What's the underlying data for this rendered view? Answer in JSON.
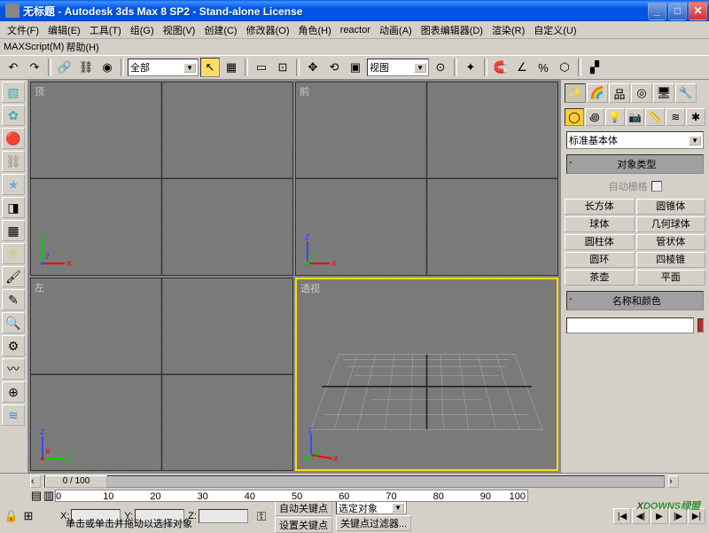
{
  "window": {
    "title": "无标题 - Autodesk 3ds Max 8 SP2 - Stand-alone License"
  },
  "menu": {
    "items": [
      "文件(F)",
      "编辑(E)",
      "工具(T)",
      "组(G)",
      "视图(V)",
      "创建(C)",
      "修改器(O)",
      "角色(H)",
      "reactor",
      "动画(A)",
      "图表编辑器(D)",
      "渲染(R)",
      "自定义(U)"
    ],
    "row2": [
      "MAXScript(M)",
      "帮助(H)"
    ]
  },
  "toolbar": {
    "dropdown1": "全部",
    "dropdown2": "视图"
  },
  "viewports": {
    "top": "顶",
    "front": "前",
    "left": "左",
    "persp": "透视"
  },
  "panel": {
    "category": "标准基本体",
    "rollout_objtype": "对象类型",
    "autogrid": "自动栅格",
    "primitives": [
      "长方体",
      "圆锥体",
      "球体",
      "几何球体",
      "圆柱体",
      "管状体",
      "圆环",
      "四棱锥",
      "茶壶",
      "平面"
    ],
    "rollout_name": "名称和颜色",
    "name_value": "",
    "color": "#b03030"
  },
  "timeline": {
    "slider": "0 / 100",
    "ticks": [
      "0",
      "10",
      "20",
      "30",
      "40",
      "50",
      "60",
      "70",
      "80",
      "90",
      "100"
    ]
  },
  "status": {
    "x_label": "X:",
    "x_val": "",
    "y_label": "Y:",
    "y_val": "",
    "z_label": "Z:",
    "z_val": "",
    "autokey": "自动关键点",
    "selected": "选定对象",
    "setkey": "设置关键点",
    "keyfilter": "关键点过滤器...",
    "prompt": "单击或单击并拖动以选择对象"
  },
  "watermark": "DOWNS绿盟"
}
